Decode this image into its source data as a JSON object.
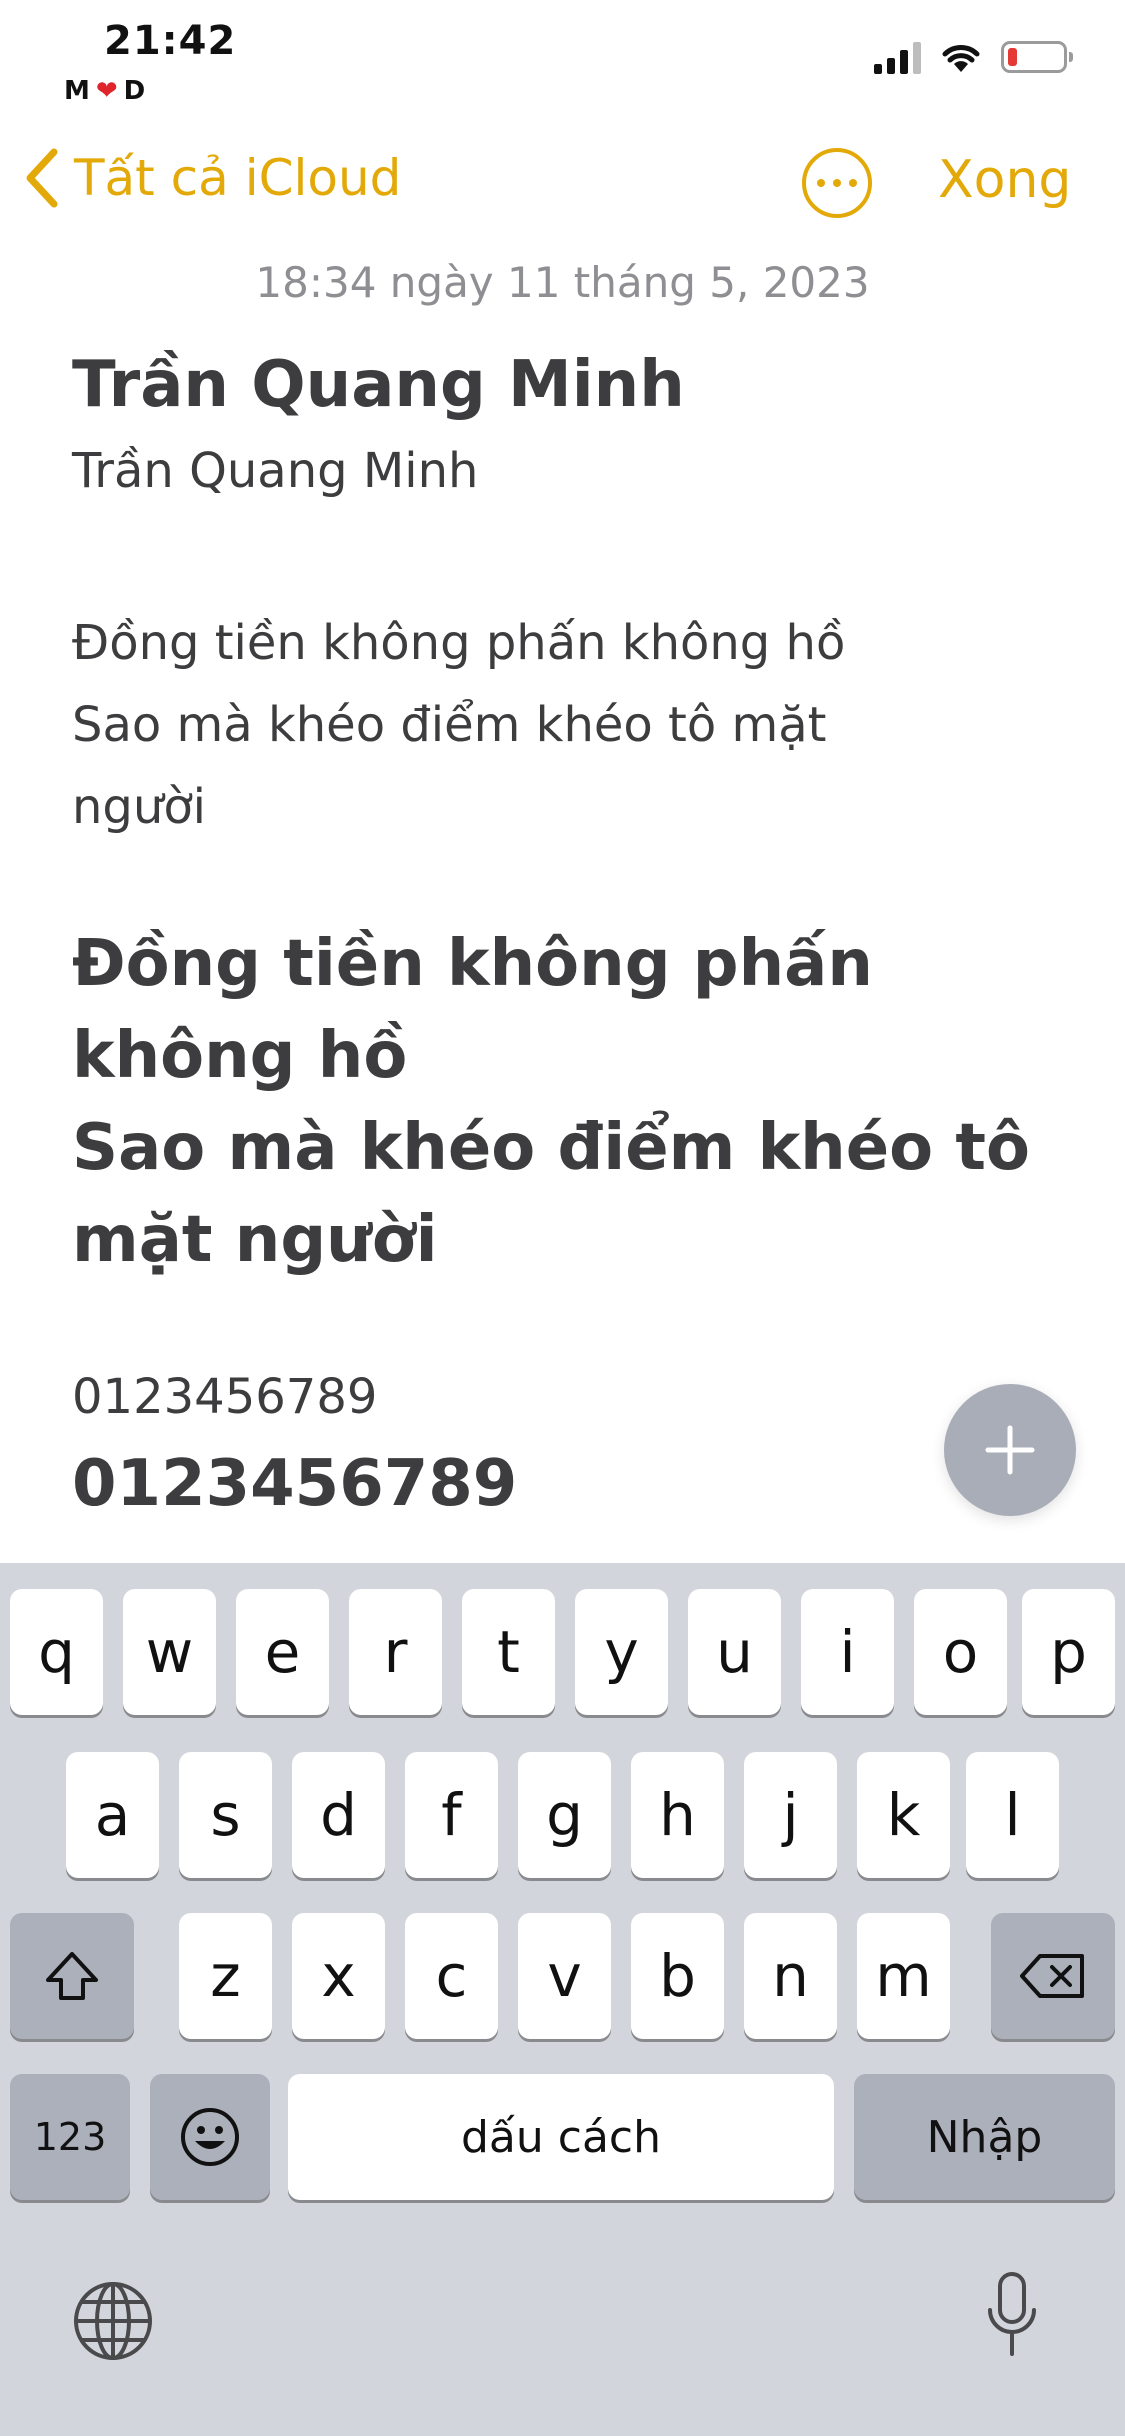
{
  "status_bar": {
    "time": "21:42",
    "carrier_left": "M",
    "carrier_right": "D"
  },
  "nav": {
    "back_label": "Tất cả iCloud",
    "done_label": "Xong"
  },
  "note": {
    "date": "18:34 ngày 11 tháng 5, 2023",
    "title": "Trần Quang Minh",
    "subtitle": "Trần Quang Minh",
    "poem_regular": [
      "Đồng tiền không phấn không hồ",
      "Sao mà khéo điểm khéo tô mặt",
      "người"
    ],
    "poem_bold": [
      "Đồng tiền không phấn",
      "không hồ",
      "Sao mà khéo điểm khéo tô",
      "mặt người"
    ],
    "digits_regular": "0123456789",
    "digits_bold": "0123456789"
  },
  "keyboard": {
    "row1": [
      "q",
      "w",
      "e",
      "r",
      "t",
      "y",
      "u",
      "i",
      "o",
      "p"
    ],
    "row2": [
      "a",
      "s",
      "d",
      "f",
      "g",
      "h",
      "j",
      "k",
      "l"
    ],
    "row3": [
      "z",
      "x",
      "c",
      "v",
      "b",
      "n",
      "m"
    ],
    "numbers_label": "123",
    "space_label": "dấu cách",
    "return_label": "Nhập"
  },
  "colors": {
    "accent": "#e3a908",
    "text": "#3d3d3f",
    "muted": "#8e8e93",
    "keyboard_bg": "#d2d5db",
    "key_dark": "#abb0ba",
    "battery_low": "#e53935"
  },
  "icons": [
    "chevron-left-icon",
    "more-icon",
    "plus-icon",
    "shift-icon",
    "backspace-icon",
    "emoji-icon",
    "globe-icon",
    "microphone-icon",
    "signal-icon",
    "wifi-icon",
    "battery-icon"
  ]
}
